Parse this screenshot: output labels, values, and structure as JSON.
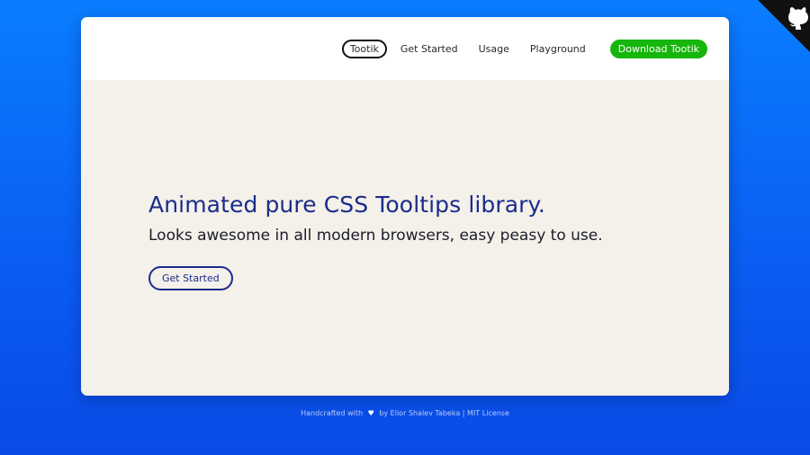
{
  "nav": {
    "active_label": "Tootik",
    "links": [
      "Get Started",
      "Usage",
      "Playground"
    ],
    "download_label": "Download Tootik"
  },
  "hero": {
    "title": "Animated pure CSS Tooltips library.",
    "subtitle": "Looks awesome in all modern browsers, easy peasy to use.",
    "cta_label": "Get Started"
  },
  "footer": {
    "prefix": "Handcrafted with",
    "heart": "♥",
    "author": "by Elior Shalev Tabeka",
    "separator": "|",
    "license": "MIT License"
  },
  "colors": {
    "accent_green": "#17b60c",
    "brand_blue": "#1a2c8a",
    "page_background": "#0a6af6",
    "card_background": "#f4f0ea"
  },
  "icons": {
    "corner": "github-icon"
  }
}
